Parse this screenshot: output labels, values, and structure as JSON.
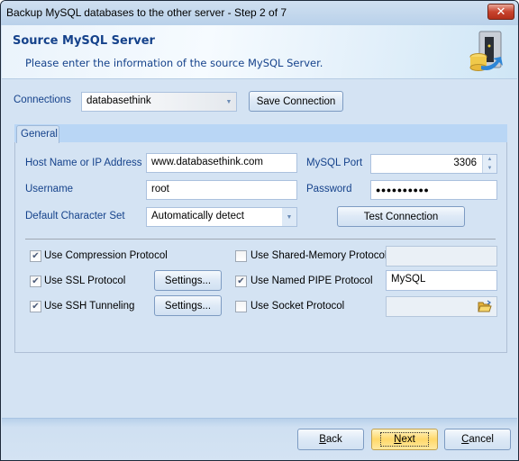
{
  "window": {
    "title": "Backup MySQL databases to the other server - Step 2 of 7",
    "close_label": "✕"
  },
  "header": {
    "title": "Source MySQL Server",
    "subtitle": "Please enter the information of the source MySQL Server.",
    "icon": "server-database-icon"
  },
  "connections": {
    "label": "Connections",
    "value": "databasethink",
    "save_button": "Save Connection"
  },
  "tabs": [
    {
      "label": "General",
      "active": true
    }
  ],
  "form": {
    "host_label": "Host Name or IP Address",
    "host_value": "www.databasethink.com",
    "port_label": "MySQL Port",
    "port_value": "3306",
    "username_label": "Username",
    "username_value": "root",
    "password_label": "Password",
    "password_value": "●●●●●●●●●●",
    "charset_label": "Default Character Set",
    "charset_value": "Automatically detect",
    "test_button": "Test Connection"
  },
  "options": {
    "compression": {
      "label": "Use Compression Protocol",
      "checked": true
    },
    "ssl": {
      "label": "Use SSL Protocol",
      "checked": true,
      "settings_button": "Settings..."
    },
    "ssh": {
      "label": "Use SSH Tunneling",
      "checked": true,
      "settings_button": "Settings..."
    },
    "shared_memory": {
      "label": "Use Shared-Memory Protocol",
      "checked": false,
      "value": ""
    },
    "named_pipe": {
      "label": "Use Named PIPE Protocol",
      "checked": true,
      "value": "MySQL"
    },
    "socket": {
      "label": "Use Socket Protocol",
      "checked": false,
      "value": ""
    }
  },
  "footer": {
    "back": {
      "prefix": "",
      "mnemonic": "B",
      "rest": "ack"
    },
    "next": {
      "prefix": "",
      "mnemonic": "N",
      "rest": "ext"
    },
    "cancel": {
      "prefix": "",
      "mnemonic": "C",
      "rest": "ancel"
    }
  }
}
